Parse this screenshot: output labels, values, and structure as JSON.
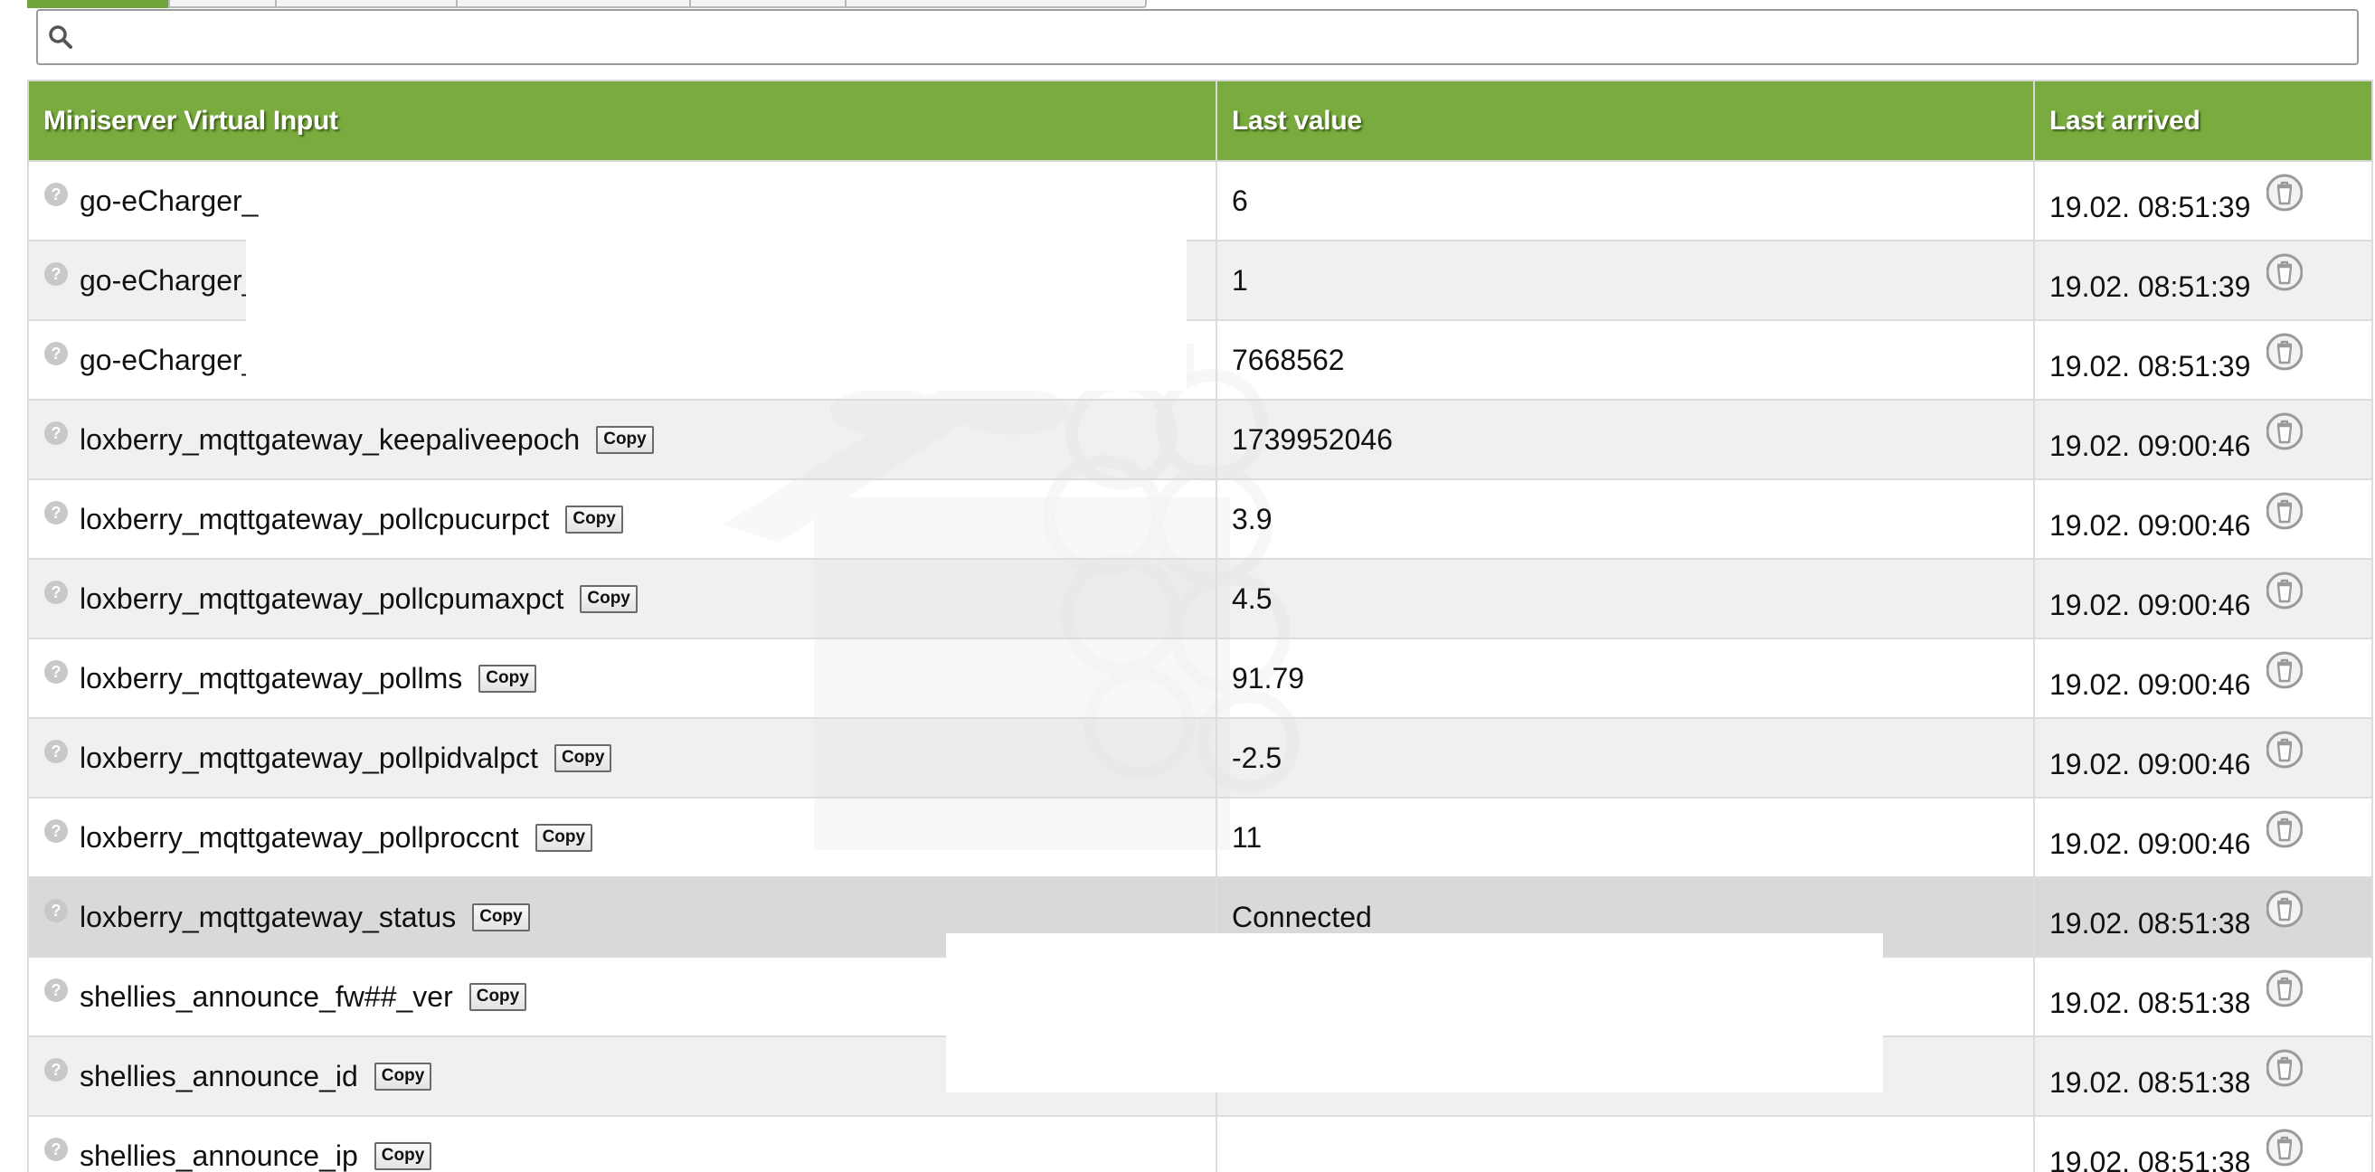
{
  "search": {
    "placeholder": "",
    "value": ""
  },
  "table": {
    "headers": [
      "Miniserver Virtual Input",
      "Last value",
      "Last arrived"
    ],
    "copy_label": "Copy",
    "rows": [
      {
        "name": "go-eCharger_",
        "value": "6",
        "arrived": "19.02. 08:51:39",
        "copy": false
      },
      {
        "name": "go-eCharger_",
        "value": "1",
        "arrived": "19.02. 08:51:39",
        "copy": false
      },
      {
        "name": "go-eCharger_",
        "value": "7668562",
        "arrived": "19.02. 08:51:39",
        "copy": false
      },
      {
        "name": "loxberry_mqttgateway_keepaliveepoch",
        "value": "1739952046",
        "arrived": "19.02. 09:00:46",
        "copy": true
      },
      {
        "name": "loxberry_mqttgateway_pollcpucurpct",
        "value": "3.9",
        "arrived": "19.02. 09:00:46",
        "copy": true
      },
      {
        "name": "loxberry_mqttgateway_pollcpumaxpct",
        "value": "4.5",
        "arrived": "19.02. 09:00:46",
        "copy": true
      },
      {
        "name": "loxberry_mqttgateway_pollms",
        "value": "91.79",
        "arrived": "19.02. 09:00:46",
        "copy": true
      },
      {
        "name": "loxberry_mqttgateway_pollpidvalpct",
        "value": "-2.5",
        "arrived": "19.02. 09:00:46",
        "copy": true
      },
      {
        "name": "loxberry_mqttgateway_pollproccnt",
        "value": "11",
        "arrived": "19.02. 09:00:46",
        "copy": true
      },
      {
        "name": "loxberry_mqttgateway_status",
        "value": "Connected",
        "arrived": "19.02. 08:51:38",
        "copy": true
      },
      {
        "name": "shellies_announce_fw##_ver",
        "value": "",
        "arrived": "19.02. 08:51:38",
        "copy": true
      },
      {
        "name": "shellies_announce_id",
        "value": "",
        "arrived": "19.02. 08:51:38",
        "copy": true
      },
      {
        "name": "shellies_announce_ip",
        "value": "",
        "arrived": "19.02. 08:51:38",
        "copy": true
      }
    ]
  },
  "icons": {
    "search": "search-icon",
    "help": "question-icon",
    "delete": "trash-icon"
  },
  "colors": {
    "header_bg": "#7aab3e",
    "active_tab": "#6fa53a",
    "selected_row": "#d6d6d6"
  }
}
